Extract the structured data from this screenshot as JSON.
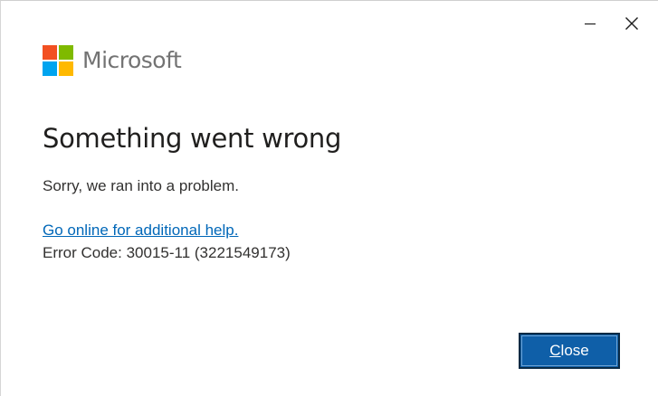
{
  "window": {
    "minimize_icon": "minimize-icon",
    "close_icon": "close-icon"
  },
  "brand": {
    "name": "Microsoft",
    "logo_colors": [
      "#f25022",
      "#7fba00",
      "#00a4ef",
      "#ffb900"
    ]
  },
  "dialog": {
    "title": "Something went wrong",
    "message": "Sorry, we ran into a problem.",
    "help_link": "Go online for additional help.",
    "error_code": "Error Code: 30015-11 (3221549173)"
  },
  "buttons": {
    "close_mnemonic": "C",
    "close_rest": "lose"
  },
  "colors": {
    "link": "#0067b8",
    "primary_button": "#0f5fa8"
  }
}
